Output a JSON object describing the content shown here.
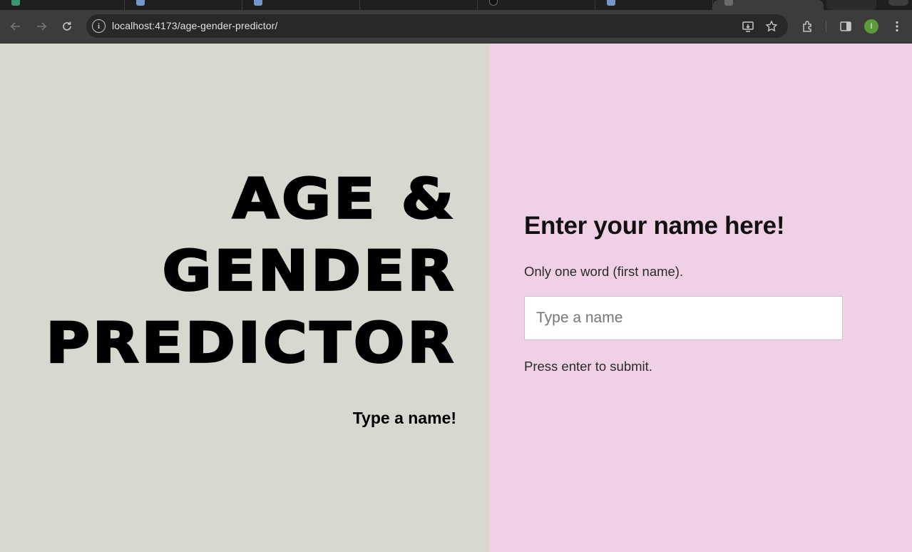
{
  "browser": {
    "url": "localhost:4173/age-gender-predictor/",
    "profile_initial": "I"
  },
  "page": {
    "title_lines": [
      "AGE &",
      "GENDER",
      "PREDICTOR"
    ],
    "left_subtitle": "Type a name!",
    "form": {
      "heading": "Enter your name here!",
      "hint": "Only one word (first name).",
      "input_placeholder": "Type a name",
      "input_value": "",
      "footer": "Press enter to submit."
    }
  },
  "colors": {
    "left_bg": "#d8d8d1",
    "right_bg": "#efd0e6",
    "toolbar_bg": "#3c3c3c"
  }
}
